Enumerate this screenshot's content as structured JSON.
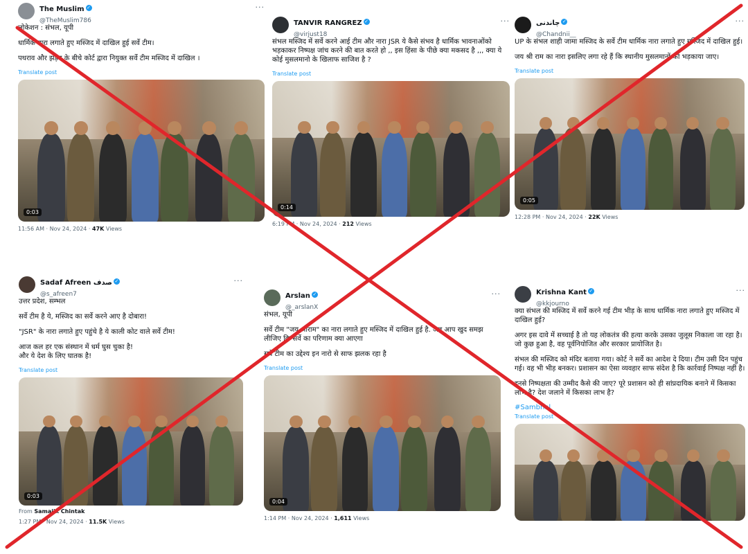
{
  "colors": {
    "verified": "#1d9bf0",
    "cross": "#e0262b",
    "link": "#1d9bf0"
  },
  "icons": {
    "verified": "verified-badge-icon",
    "more": "more-options-icon"
  },
  "posts": [
    {
      "display_name": "The Muslim",
      "handle": "@TheMuslim786",
      "paragraphs": [
        "लोकेशन : संभल, यूपी",
        "धार्मिक नारा लगाते हुए मस्जिद में दाखिल हुई सर्वे टीम।",
        "पथराव और झड़प के बीचे कोर्ट द्वारा नियुक्त सर्वे टीम मस्जिद में दाखिल ।"
      ],
      "hashtag": "",
      "translate": "Translate post",
      "duration": "0:03",
      "from_label": "",
      "from_name": "",
      "timestamp": "11:56 AM · Nov 24, 2024 · ",
      "views_count": "47K",
      "views_label": " Views"
    },
    {
      "display_name": "TANVIR RANGREZ",
      "handle": "@virjust18",
      "paragraphs": [
        "संभल मस्जिद में सर्वे करने आई टीम और नारा JSR ये कैसे संभव है धार्मिक भावनाओंको भड़काकर निष्पक्ष जांच करने की बात करते हो ,, इस हिंसा के पीछे क्या मकसद है ,,, क्या ये कोई मुसलमानो के खिलाफ साजिश है ?"
      ],
      "hashtag": "",
      "translate": "Translate post",
      "duration": "0:14",
      "from_label": "",
      "from_name": "",
      "timestamp": "6:19 PM · Nov 24, 2024 · ",
      "views_count": "212",
      "views_label": " Views"
    },
    {
      "display_name": "چاندنی",
      "handle": "@Chandnii__",
      "paragraphs": [
        "UP के संभल शाही जामा मस्जिद के सर्वे टीम धार्मिक नारा लगाते हुए मस्जिद में दाखिल हुई।",
        "जय श्री राम का नारा इसलिए लगा रहे हैं कि स्थानीय मुसलमानों को भड़काया जाए।"
      ],
      "hashtag": "",
      "translate": "Translate post",
      "duration": "0:05",
      "from_label": "",
      "from_name": "",
      "timestamp": "12:28 PM · Nov 24, 2024 · ",
      "views_count": "22K",
      "views_label": " Views"
    },
    {
      "display_name": "Sadaf Afreen صدف",
      "handle": "@s_afreen7",
      "paragraphs": [
        "उत्तर प्रदेश, सम्भल",
        "सर्वे टीम है ये, मस्जिद का सर्वे करने आए है दोबारा!",
        "\"JSR\" के नारा लगाते हुए पहुंचे है ये काली कोट वाले सर्वे टीम!",
        "आज कल हर एक संस्थान में धर्म घुस चुका है!\nऔर ये देश के लिए घातक है!"
      ],
      "hashtag": "",
      "translate": "Translate post",
      "duration": "0:03",
      "from_label": "From ",
      "from_name": "Samajik Chintak",
      "timestamp": "1:27 PM · Nov 24, 2024 · ",
      "views_count": "11.5K",
      "views_label": " Views"
    },
    {
      "display_name": "Arslan",
      "handle": "@_arslanX",
      "paragraphs": [
        "संभल, यूपी",
        "सर्वे टीम \"जय श्रीराम\" का नारा लगाते हुए मस्जिद में दाखिल हुई है. अब आप खुद समझ लीजिए कि सर्वे का परिणाम क्या आएगा",
        "सर्वे टीम का उद्देश्य इन नारो से साफ झलक रहा है"
      ],
      "hashtag": "",
      "translate": "Translate post",
      "duration": "0:04",
      "from_label": "",
      "from_name": "",
      "timestamp": "1:14 PM · Nov 24, 2024 · ",
      "views_count": "1,611",
      "views_label": " Views"
    },
    {
      "display_name": "Krishna Kant",
      "handle": "@kkjourno",
      "paragraphs": [
        "क्या संभल की मस्जिद में सर्वे करने गई टीम भीड़ के साथ धार्मिक नारा लगाते हुए मस्जिद में दाखिल हुई?",
        "अगर इस दावे में सच्चाई है तो यह लोकतंत्र की हत्या करके उसका जुलूस निकाला जा रहा है।\nजो कुछ हुआ है, वह पूर्वनियोजित और सरकार प्रायोजित है।",
        "संभल की मस्जिद को मंदिर बताया गया। कोर्ट ने सर्वे का आदेश दे दिया। टीम उसी दिन पहुंच गई। वह भी भीड़ बनकर। प्रशासन का ऐसा व्यवहार साफ संदेश है कि कार्रवाई निष्पक्ष नहीं है।",
        "इनसे निष्पक्षता की उम्मीद कैसे की जाए? पूरे प्रशासन को ही सांप्रदायिक बनाने में किसका लाभ है? देश जलाने में किसका लाभ है?"
      ],
      "hashtag": "#Sambhal",
      "translate": "Translate post",
      "duration": "",
      "from_label": "",
      "from_name": "",
      "timestamp": "",
      "views_count": "",
      "views_label": ""
    }
  ]
}
